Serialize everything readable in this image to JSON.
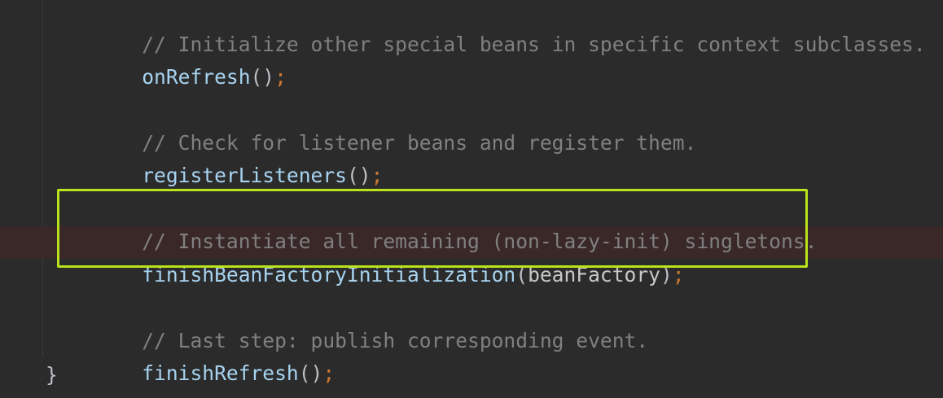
{
  "code": {
    "line1": {
      "comment": "// Initialize other special beans in specific context subclasses."
    },
    "line2": {
      "method": "onRefresh",
      "paren": "()",
      "semi": ";"
    },
    "line3": {
      "comment": "// Check for listener beans and register them."
    },
    "line4": {
      "method": "registerListeners",
      "paren": "()",
      "semi": ";"
    },
    "line5": {
      "comment": "// Instantiate all remaining (non-lazy-init) singletons."
    },
    "line6": {
      "method": "finishBeanFactoryInitialization",
      "open": "(",
      "arg": "beanFactory",
      "close": ")",
      "semi": ";"
    },
    "line7": {
      "comment": "// Last step: publish corresponding event."
    },
    "line8": {
      "method": "finishRefresh",
      "paren": "()",
      "semi": ";"
    },
    "closing_brace": "}"
  },
  "colors": {
    "background": "#2b2b2b",
    "comment": "#808080",
    "method": "#a7d3f0",
    "semicolon": "#cc7832",
    "highlight_frame": "#b9e21b",
    "highlight_row": "#3a2828"
  }
}
